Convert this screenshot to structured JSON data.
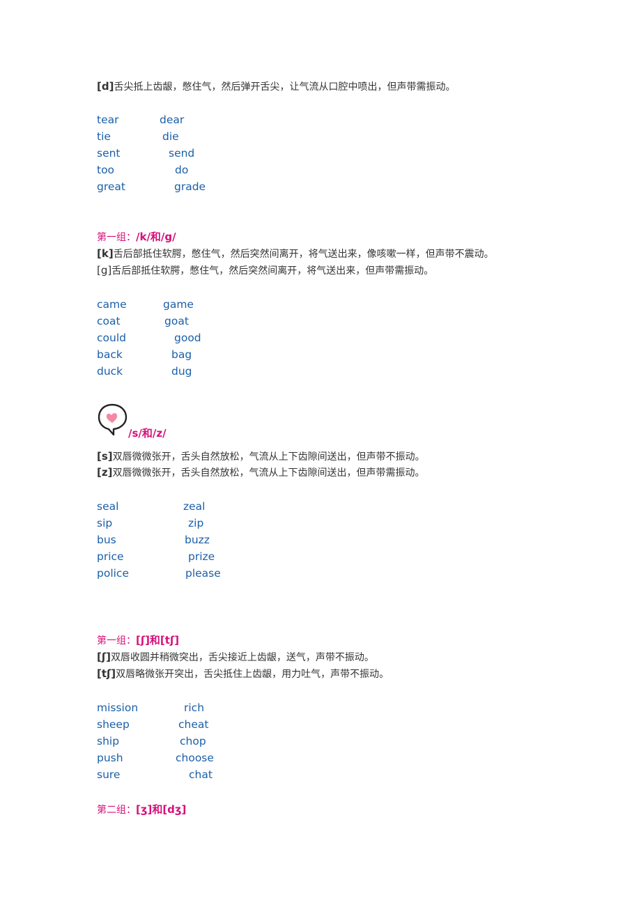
{
  "sections": [
    {
      "id": "d",
      "descriptions": [
        {
          "symbol": "[d]",
          "text": "舌尖抵上齿龈，憋住气，然后弹开舌尖，让气流从口腔中喷出，但声带需振动。"
        }
      ],
      "pairs": [
        {
          "left": "tear",
          "right": "dear"
        },
        {
          "left": "tie",
          "right": "die"
        },
        {
          "left": "sent",
          "right": "send"
        },
        {
          "left": "too",
          "right": "do"
        },
        {
          "left": "great",
          "right": "grade"
        }
      ]
    },
    {
      "id": "kg",
      "heading": {
        "prefix": "第一组：",
        "symbols": "/k/和/g/"
      },
      "descriptions": [
        {
          "symbol": "[k]",
          "text": "舌后部抵住软腭，憋住气，然后突然间离开，将气送出来，像咳嗽一样，但声带不震动。"
        },
        {
          "symbol": "[g]",
          "text": "舌后部抵住软腭，憋住气，然后突然间离开，将气送出来，但声带需振动。"
        }
      ],
      "pairs": [
        {
          "left": "came",
          "right": "game"
        },
        {
          "left": "coat",
          "right": "goat"
        },
        {
          "left": "could",
          "right": "good"
        },
        {
          "left": "back",
          "right": "bag"
        },
        {
          "left": "duck",
          "right": "dug"
        }
      ]
    },
    {
      "id": "sz",
      "heading": {
        "icon": "heart-speech-bubble-icon",
        "symbols": "/s/和/z/"
      },
      "descriptions": [
        {
          "symbol": "[s]",
          "text": "双唇微微张开，舌头自然放松，气流从上下齿隙间送出，但声带不振动。"
        },
        {
          "symbol": "[z]",
          "text": "双唇微微张开，舌头自然放松，气流从上下齿隙间送出，但声带需振动。"
        }
      ],
      "pairs": [
        {
          "left": "seal",
          "right": "zeal"
        },
        {
          "left": "sip",
          "right": "zip"
        },
        {
          "left": "bus",
          "right": "buzz"
        },
        {
          "left": "price",
          "right": "prize"
        },
        {
          "left": "police",
          "right": "please"
        }
      ]
    },
    {
      "id": "sh-ch",
      "heading": {
        "prefix": "第一组：",
        "symbols": "[ʃ]和[tʃ]"
      },
      "descriptions": [
        {
          "symbol": "[ʃ]",
          "text": "双唇收圆并稍微突出，舌尖接近上齿龈，送气，声带不振动。"
        },
        {
          "symbol": "[tʃ]",
          "text": "双唇略微张开突出，舌尖抵住上齿龈，用力吐气，声带不振动。"
        }
      ],
      "pairs": [
        {
          "left": "mission",
          "right": "rich"
        },
        {
          "left": "sheep",
          "right": "cheat"
        },
        {
          "left": "ship",
          "right": "chop"
        },
        {
          "left": "push",
          "right": "choose"
        },
        {
          "left": "sure",
          "right": "chat"
        }
      ]
    },
    {
      "id": "zh-j",
      "heading": {
        "prefix": "第二组：",
        "symbols": "[ʒ]和[dʒ]"
      }
    }
  ],
  "colors": {
    "heading": "#d6107a",
    "word": "#1a5fa8",
    "body": "#333333"
  }
}
